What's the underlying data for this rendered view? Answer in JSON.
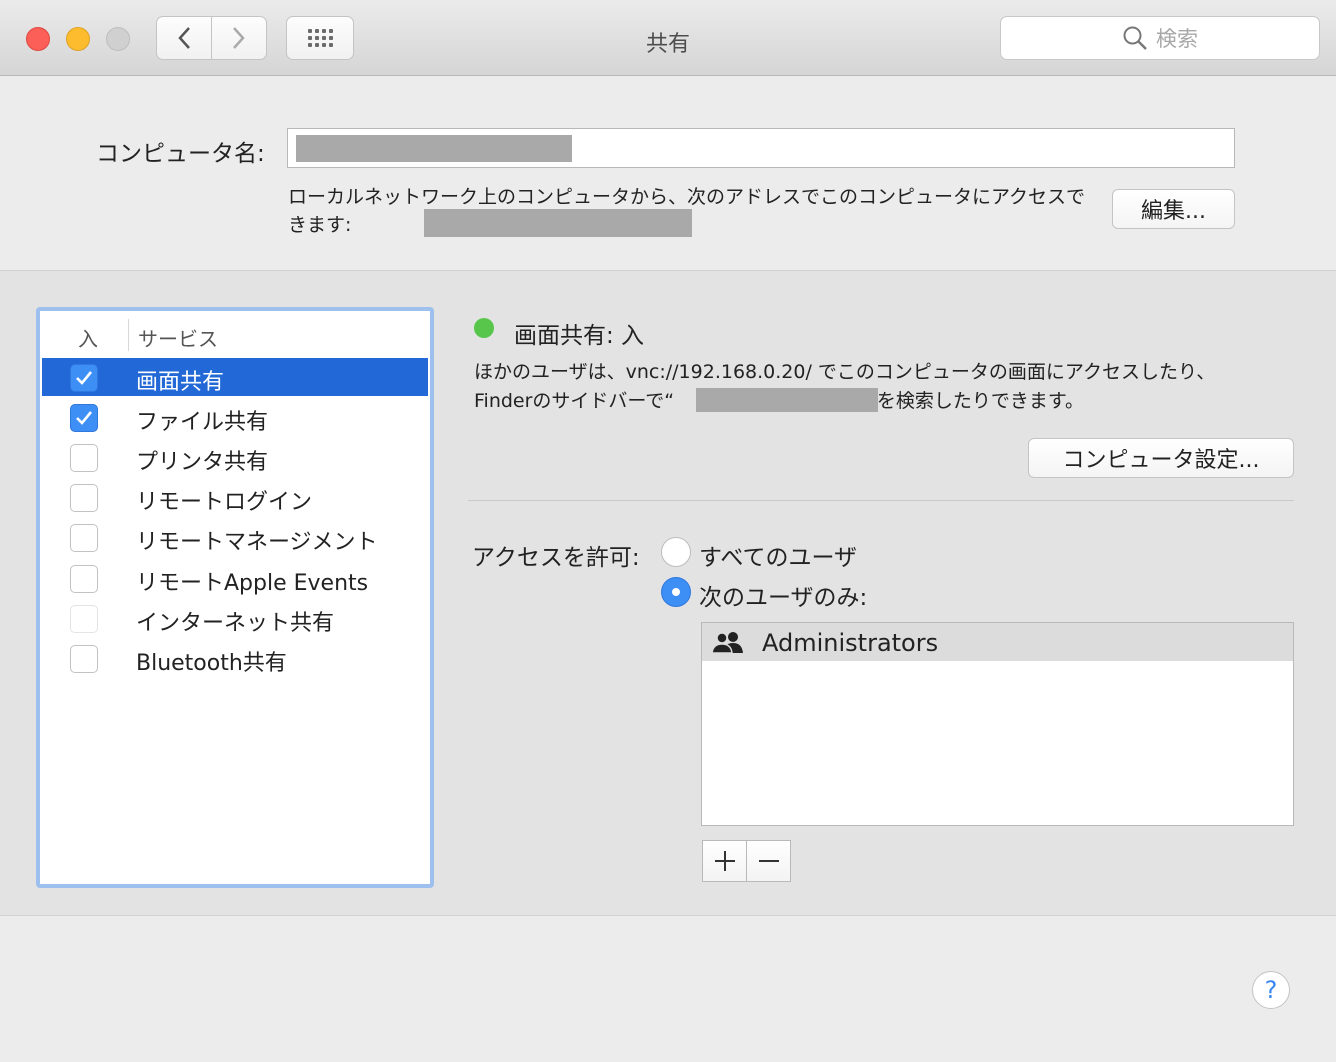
{
  "window": {
    "title": "共有",
    "search_placeholder": "検索"
  },
  "computer_name": {
    "label": "コンピュータ名:",
    "value": "",
    "description": "ローカルネットワーク上のコンピュータから、次のアドレスでこのコンピュータにアクセスできます:",
    "edit_label": "編集..."
  },
  "services": {
    "header_on": "入",
    "header_service": "サービス",
    "items": [
      {
        "label": "画面共有",
        "checked": true,
        "selected": true
      },
      {
        "label": "ファイル共有",
        "checked": true,
        "selected": false
      },
      {
        "label": "プリンタ共有",
        "checked": false,
        "selected": false
      },
      {
        "label": "リモートログイン",
        "checked": false,
        "selected": false
      },
      {
        "label": "リモートマネージメント",
        "checked": false,
        "selected": false
      },
      {
        "label": "リモートApple Events",
        "checked": false,
        "selected": false
      },
      {
        "label": "インターネット共有",
        "checked": false,
        "selected": false
      },
      {
        "label": "Bluetooth共有",
        "checked": false,
        "selected": false
      }
    ]
  },
  "detail": {
    "status": "画面共有: 入",
    "status_color": "#57c64a",
    "info_line1": "ほかのユーザは、vnc://192.168.0.20/ でこのコンピュータの画面にアクセスしたり、",
    "info_line2_prefix": "Finderのサイドバーで“",
    "info_line2_suffix": "o”を検索したりできます。",
    "computer_settings_label": "コンピュータ設定...",
    "access_label": "アクセスを許可:",
    "radio_all": "すべてのユーザ",
    "radio_only": "次のユーザのみ:",
    "users": [
      "Administrators"
    ],
    "plus_label": "+",
    "minus_label": "−"
  },
  "help_label": "?",
  "colors": {
    "selection": "#2268d6",
    "checkbox_checked": "#3d8ef5",
    "list_focus_border": "#9ec0ee"
  }
}
